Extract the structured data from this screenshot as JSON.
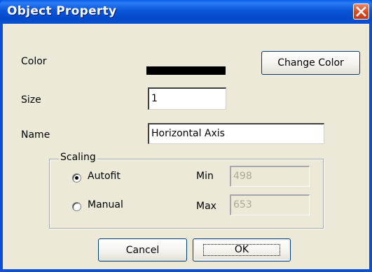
{
  "dialog": {
    "title": "Object Property",
    "color_label": "Color",
    "color_value": "#000000",
    "change_color_label": "Change Color",
    "size_label": "Size",
    "size_value": "1",
    "name_label": "Name",
    "name_value": "Horizontal Axis",
    "scaling": {
      "legend": "Scaling",
      "autofit_label": "Autofit",
      "manual_label": "Manual",
      "selected": "autofit",
      "min_label": "Min",
      "min_value": "498",
      "max_label": "Max",
      "max_value": "653"
    },
    "cancel_label": "Cancel",
    "ok_label": "OK"
  },
  "icons": {
    "close": "close-icon"
  },
  "colors": {
    "titlebar": "#0054e3",
    "close_button": "#d9481f",
    "face": "#ece9d8"
  }
}
